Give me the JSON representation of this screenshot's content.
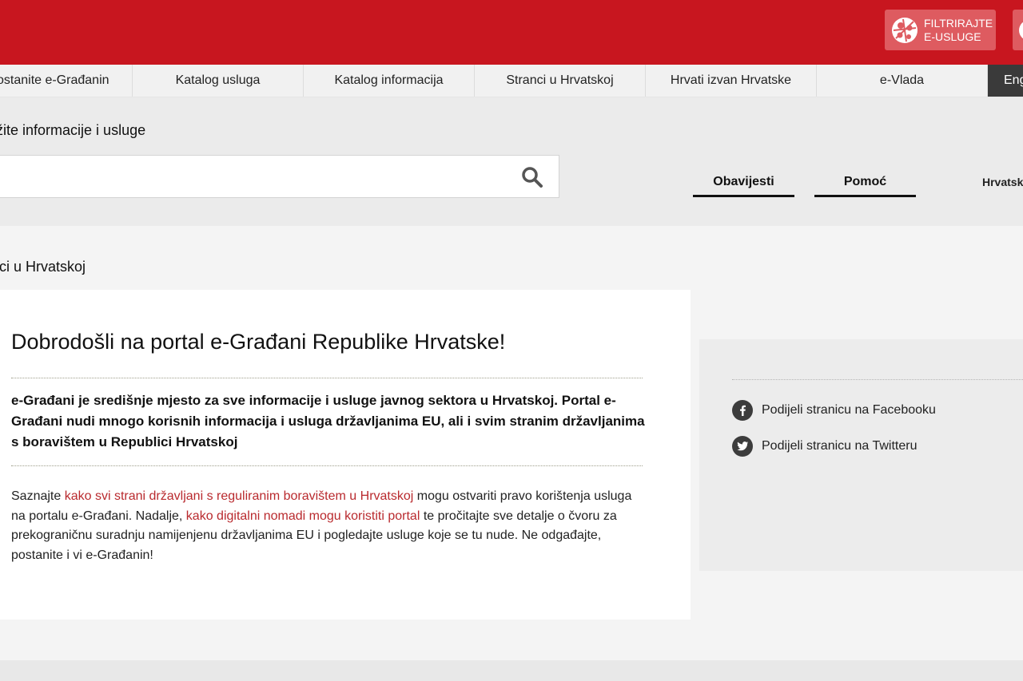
{
  "colors": {
    "brand_red": "#c8161f",
    "filter_button": "#de5b60",
    "link": "#b92a2e",
    "lang_button": "#3a3a3a"
  },
  "header": {
    "filter_button": {
      "line1": "FILTRIRAJTE",
      "line2": "E-USLUGE",
      "icon": "globe-icon"
    }
  },
  "nav": {
    "items": [
      "ostanite e-Građanin",
      "Katalog usluga",
      "Katalog informacija",
      "Stranci u Hrvatskoj",
      "Hrvati izvan Hrvatske",
      "e-Vlada"
    ],
    "language": "Eng"
  },
  "search": {
    "label": "ažite informacije i usluge",
    "placeholder": "",
    "icon": "search-icon"
  },
  "tabs": {
    "notifications": "Obavijesti",
    "help": "Pomoć"
  },
  "language_select": "Hrvatski",
  "breadcrumb": "nci u Hrvatskoj",
  "main": {
    "title": "Dobrodošli na portal e-Građani Republike Hrvatske!",
    "lead": "e-Građani je središnje mjesto za sve informacije i usluge javnog sektora u Hrvatskoj. Portal e-Građani nudi mnogo korisnih informacija i usluga državljanima EU, ali i svim stranim državljanima s boravištem u Republici Hrvatskoj",
    "body": {
      "part1": "Saznajte ",
      "link1": "kako svi strani državljani s reguliranim boravištem u Hrvatskoj",
      "part2": " mogu ostvariti pravo korištenja usluga na portalu e-Građani. Nadalje, ",
      "link2": "kako digitalni nomadi mogu koristiti portal",
      "part3": " te pročitajte sve detalje o čvoru za prekograničnu suradnju namijenjenu državljanima EU i pogledajte usluge koje se tu nude. Ne odgađajte, postanite i vi e-Građanin!"
    }
  },
  "share": {
    "facebook": {
      "label": "Podijeli stranicu na Facebooku",
      "icon": "facebook-icon"
    },
    "twitter": {
      "label": "Podijeli stranicu na Twitteru",
      "icon": "twitter-icon"
    }
  }
}
